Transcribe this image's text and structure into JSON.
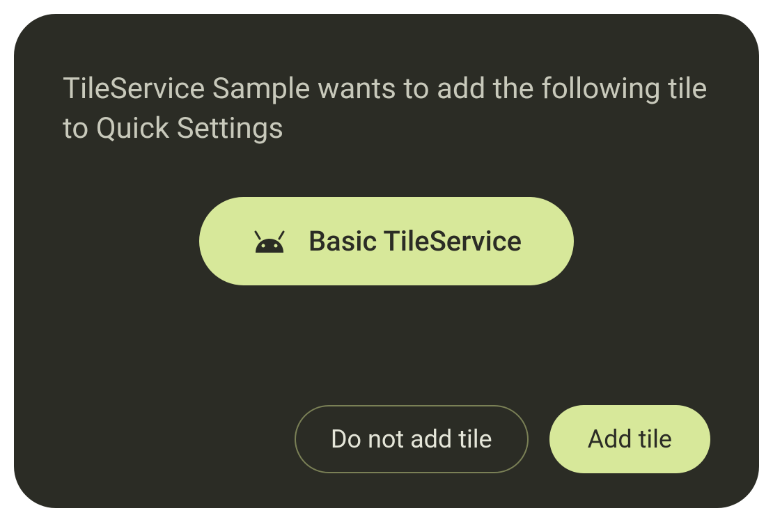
{
  "dialog": {
    "message": "TileService Sample wants to add the following tile to Quick Settings",
    "tile": {
      "icon": "android-icon",
      "label": "Basic TileService"
    },
    "actions": {
      "cancel_label": "Do not add tile",
      "confirm_label": "Add tile"
    }
  },
  "colors": {
    "background": "#2b2c25",
    "accent": "#d7e89a",
    "text_muted": "#c8c9bb",
    "border": "#7a8056"
  }
}
